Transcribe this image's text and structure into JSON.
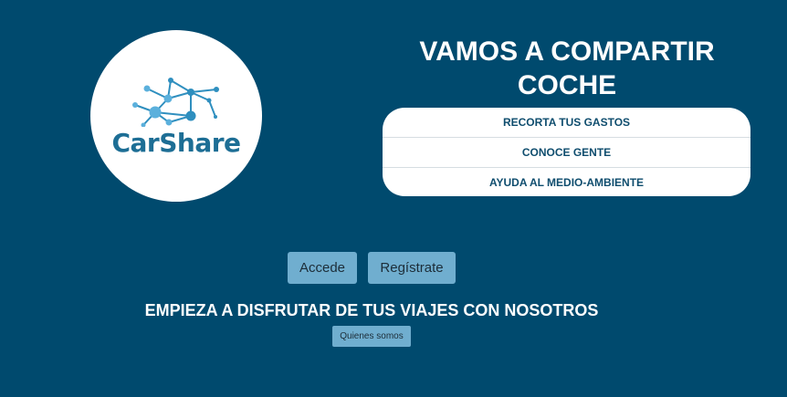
{
  "brand": {
    "name": "CarShare",
    "primary_color": "#1d6e95",
    "accent_color": "#5bb0dc"
  },
  "hero": {
    "headline": "VAMOS A COMPARTIR COCHE"
  },
  "features": [
    {
      "label": "RECORTA TUS GASTOS"
    },
    {
      "label": "CONOCE GENTE"
    },
    {
      "label": "AYUDA AL MEDIO-AMBIENTE"
    }
  ],
  "actions": {
    "login_label": "Accede",
    "register_label": "Regístrate"
  },
  "tagline": "EMPIEZA A DISFRUTAR DE TUS VIAJES CON NOSOTROS",
  "about_label": "Quienes somos",
  "colors": {
    "background": "#004a6e",
    "button": "#70aecf",
    "panel": "#ffffff"
  }
}
